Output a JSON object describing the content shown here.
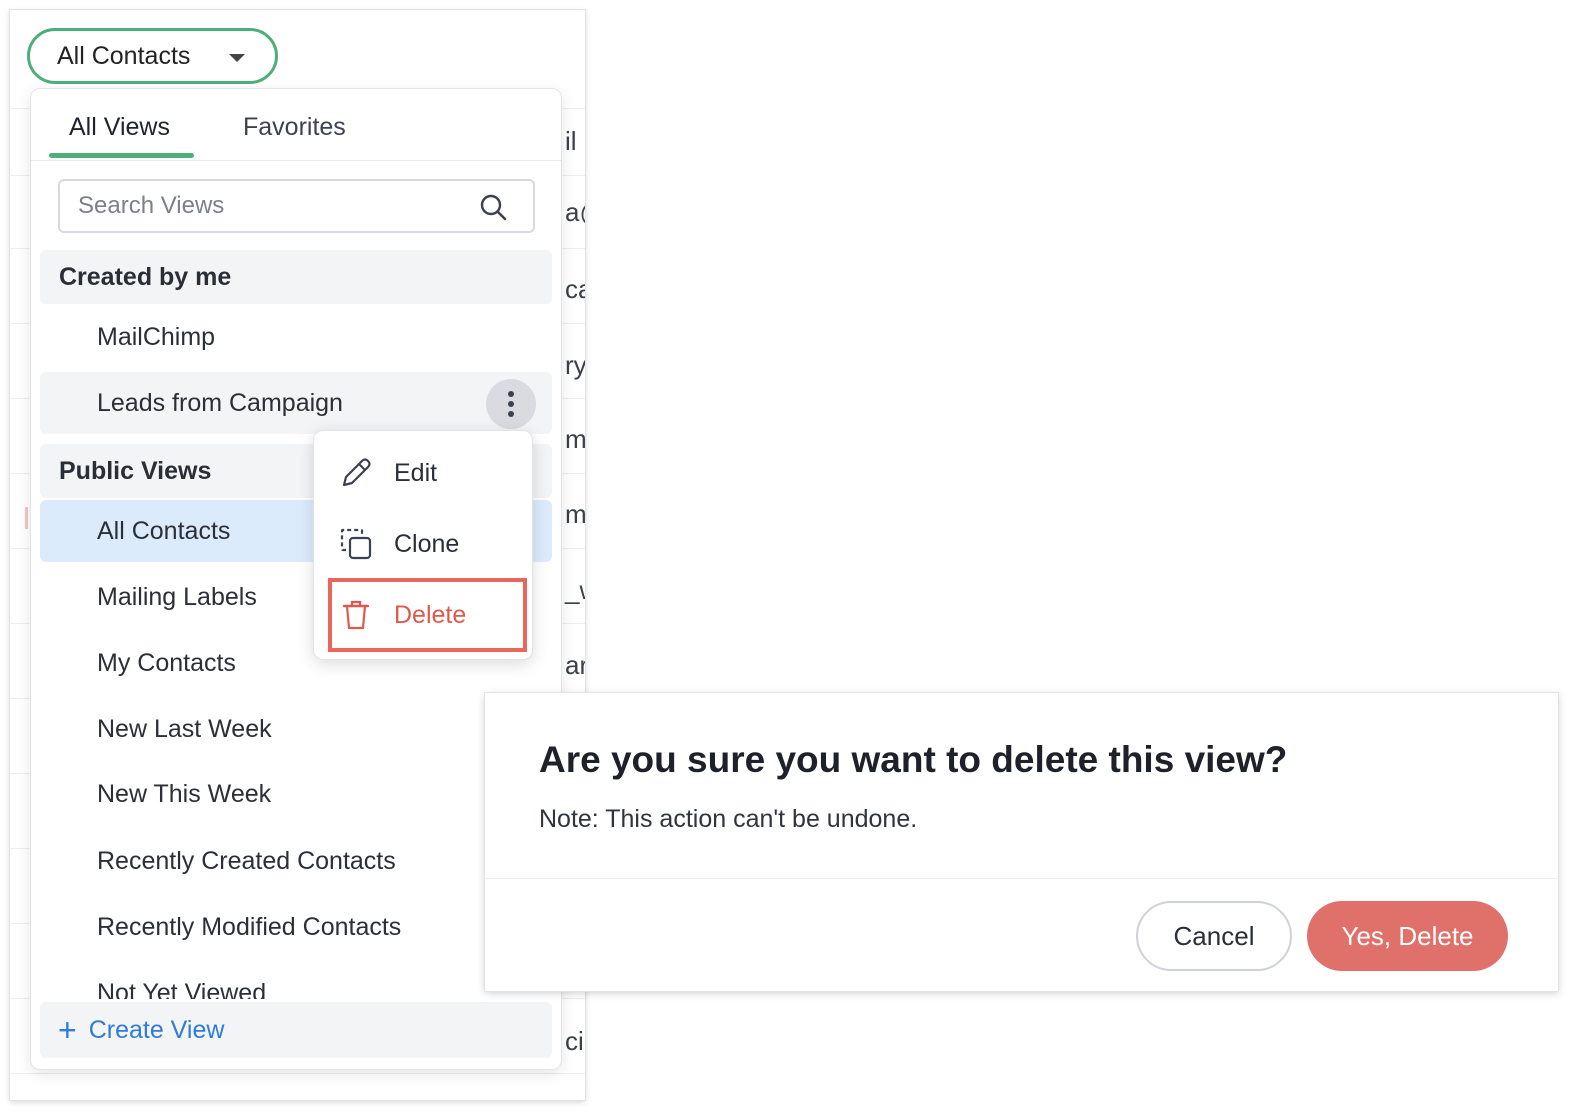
{
  "view_selector": {
    "label": "All Contacts"
  },
  "tabs": [
    {
      "label": "All Views",
      "active": true
    },
    {
      "label": "Favorites",
      "active": false
    }
  ],
  "search": {
    "placeholder": "Search Views",
    "value": ""
  },
  "sections": {
    "created_by_me": {
      "header": "Created by me",
      "items": [
        "MailChimp",
        "Leads from Campaign"
      ]
    },
    "public_views": {
      "header": "Public Views",
      "items": [
        "All Contacts",
        "Mailing Labels",
        "My Contacts",
        "New Last Week",
        "New This Week",
        "Recently Created Contacts",
        "Recently Modified Contacts",
        "Not Yet Viewed"
      ],
      "selected": "All Contacts"
    }
  },
  "create_view": {
    "label": "Create View"
  },
  "context_menu": {
    "items": [
      {
        "label": "Edit",
        "icon": "pencil-icon"
      },
      {
        "label": "Clone",
        "icon": "clone-icon"
      },
      {
        "label": "Delete",
        "icon": "trash-icon",
        "highlighted": true
      }
    ]
  },
  "background_fragments": [
    "il",
    "a@",
    "ca",
    "ry",
    "m",
    "m",
    "_w",
    "ar",
    "ci"
  ],
  "dialog": {
    "title": "Are you sure you want to delete this view?",
    "note": "Note: This action can't be undone.",
    "cancel_label": "Cancel",
    "confirm_label": "Yes, Delete"
  },
  "colors": {
    "accent_green": "#4caf7a",
    "link_blue": "#2f7bd8",
    "danger_red": "#e0584d",
    "danger_button": "#e0716a",
    "selected_row": "#dcebfb"
  }
}
